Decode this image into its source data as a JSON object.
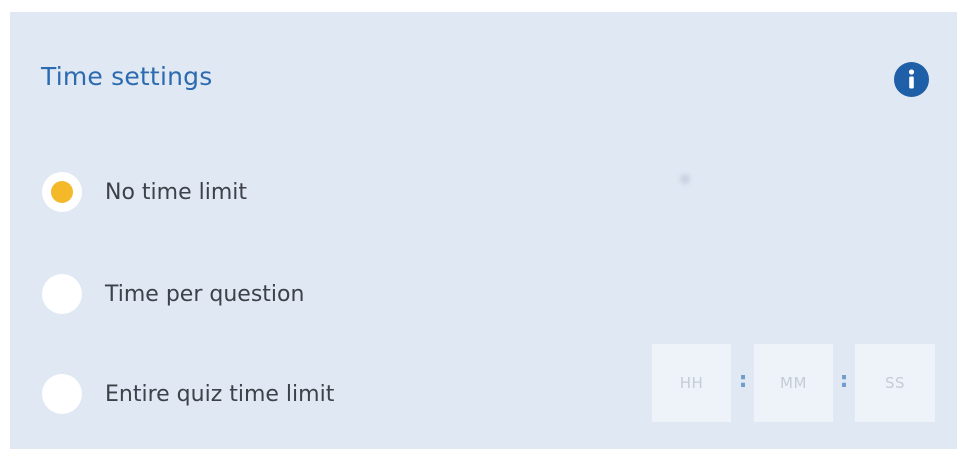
{
  "title": "Time settings",
  "info_icon": "info-icon",
  "options": [
    {
      "label": "No time limit",
      "selected": true
    },
    {
      "label": "Time per question",
      "selected": false
    },
    {
      "label": "Entire quiz time limit",
      "selected": false
    }
  ],
  "time_inputs": {
    "hours_placeholder": "HH",
    "minutes_placeholder": "MM",
    "seconds_placeholder": "SS",
    "separator": ":"
  },
  "colors": {
    "panel_bg": "#dfe8f3",
    "title": "#2c6bb0",
    "info_icon_bg": "#1f5fa8",
    "radio_selected": "#f3b929",
    "label_text": "#3d4148"
  }
}
